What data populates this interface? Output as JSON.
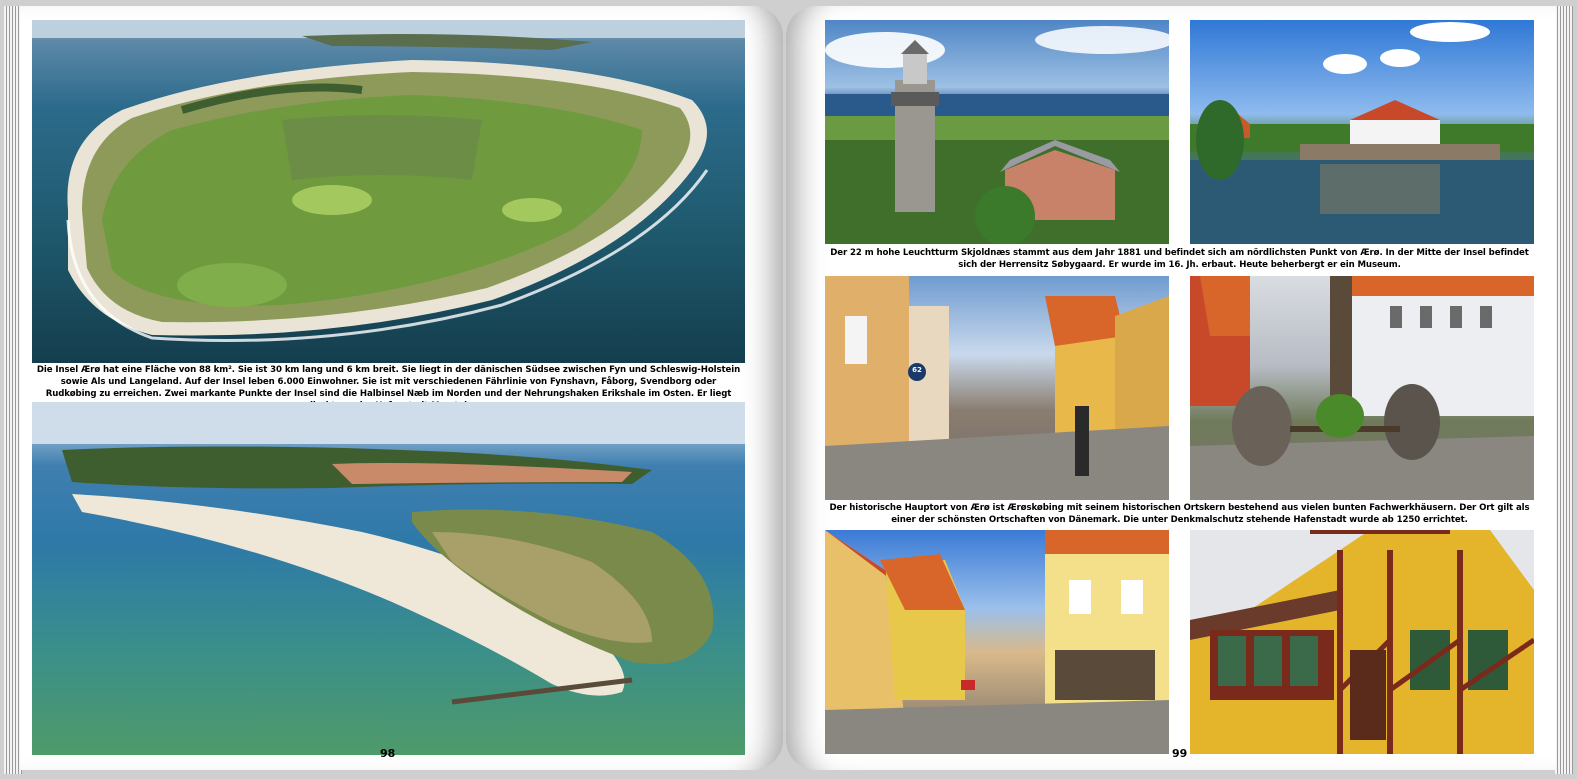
{
  "left_page": {
    "caption": "Die Insel Ærø hat eine Fläche von 88 km². Sie ist 30 km lang und 6 km breit. Sie liegt in der dänischen Südsee zwischen Fyn und Schleswig-Holstein sowie Als und Langeland. Auf der Insel leben 6.000 Einwohner. Sie ist mit verschiedenen Fährlinie von Fynshavn, Fåborg, Svendborg oder Rudkøbing zu erreichen. Zwei markante Punkte der Insel sind die Halbinsel Næb im Norden und der Nehrungshaken Erikshale im Osten. Er liegt direkt vor der Hafenstadt Marstal.",
    "page_number": "98"
  },
  "right_page": {
    "caption_top": "Der 22 m hohe  Leuchtturm Skjoldnæs stammt aus dem Jahr 1881 und befindet sich am nördlichsten Punkt von Ærø. In der Mitte der Insel befindet sich der Herrensitz Søbygaard. Er wurde im 16. Jh. erbaut. Heute beherbergt er ein Museum.",
    "caption_middle": "Der historische Hauptort von Ærø ist Ærøskøbing mit seinem historischen Ortskern bestehend aus vielen bunten Fachwerkhäusern. Der Ort gilt als einer der schönsten Ortschaften von Dänemark. Die unter Denkmalschutz stehende Hafenstadt wurde ab 1250 errichtet.",
    "page_number": "99",
    "street_sign": "62"
  }
}
